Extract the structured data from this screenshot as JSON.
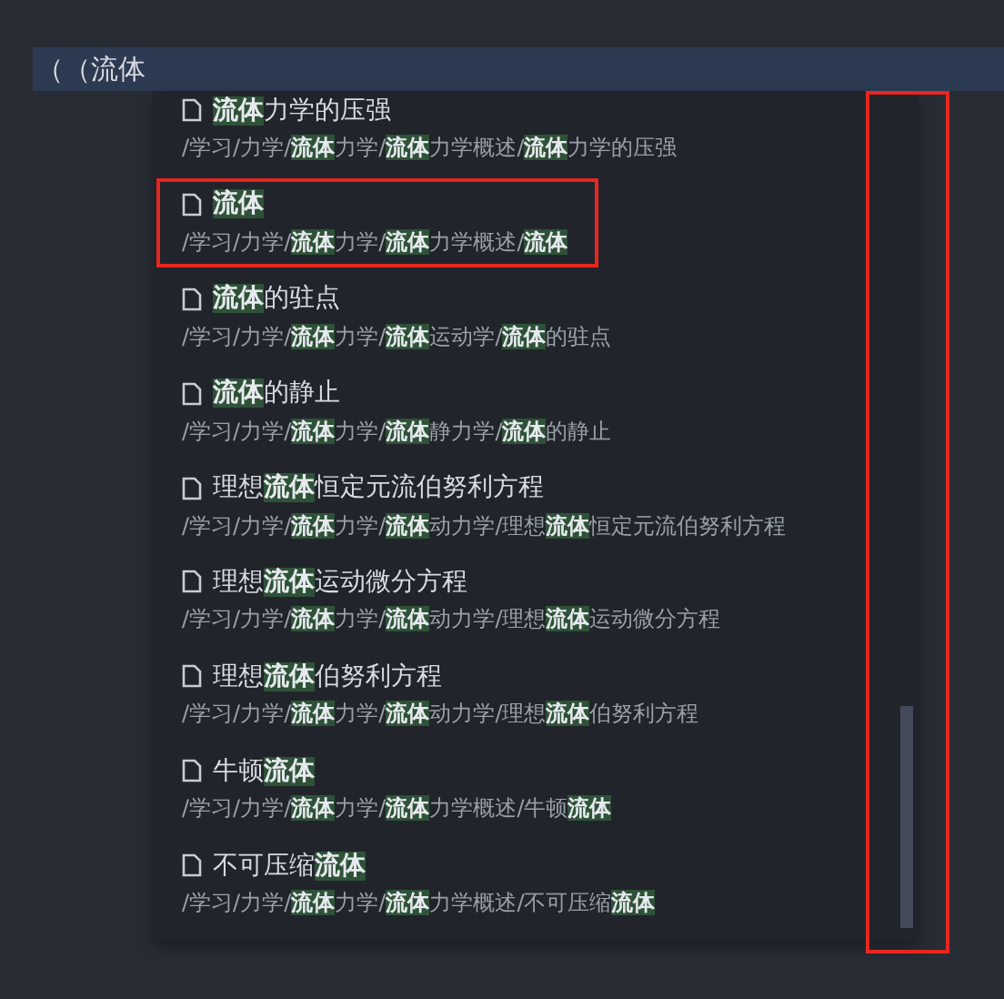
{
  "input": {
    "value": "（（流体"
  },
  "results": [
    {
      "title": "**流体**力学的压强",
      "path": "/学习/力学/**流体**力学/**流体**力学概述/**流体**力学的压强",
      "annotated": false
    },
    {
      "title": "**流体**",
      "path": "/学习/力学/**流体**力学/**流体**力学概述/**流体**",
      "annotated": true
    },
    {
      "title": "**流体**的驻点",
      "path": "/学习/力学/**流体**力学/**流体**运动学/**流体**的驻点",
      "annotated": false
    },
    {
      "title": "**流体**的静止",
      "path": "/学习/力学/**流体**力学/**流体**静力学/**流体**的静止",
      "annotated": false
    },
    {
      "title": "理想**流体**恒定元流伯努利方程",
      "path": "/学习/力学/**流体**力学/**流体**动力学/理想**流体**恒定元流伯努利方程",
      "annotated": false
    },
    {
      "title": "理想**流体**运动微分方程",
      "path": "/学习/力学/**流体**力学/**流体**动力学/理想**流体**运动微分方程",
      "annotated": false
    },
    {
      "title": "理想**流体**伯努利方程",
      "path": "/学习/力学/**流体**力学/**流体**动力学/理想**流体**伯努利方程",
      "annotated": false
    },
    {
      "title": "牛顿**流体**",
      "path": "/学习/力学/**流体**力学/**流体**力学概述/牛顿**流体**",
      "annotated": false
    },
    {
      "title": "不可压缩**流体**",
      "path": "/学习/力学/**流体**力学/**流体**力学概述/不可压缩**流体**",
      "annotated": false
    }
  ],
  "scrollbar": {
    "annotated": true
  }
}
